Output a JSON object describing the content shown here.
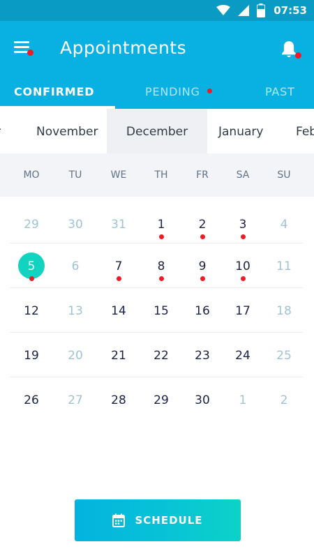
{
  "status_bar": {
    "time": "07:53",
    "icons": [
      "wifi-icon",
      "cell-signal-icon",
      "battery-icon"
    ]
  },
  "app_bar": {
    "title": "Appointments",
    "menu_icon": "menu-icon",
    "menu_has_badge": true,
    "bell_icon": "bell-icon",
    "bell_has_badge": true
  },
  "tabs": [
    {
      "label": "CONFIRMED",
      "selected": true,
      "has_badge": false
    },
    {
      "label": "PENDING",
      "selected": false,
      "has_badge": true
    },
    {
      "label": "PAST",
      "selected": false,
      "has_badge": false
    }
  ],
  "months": [
    {
      "label": "r",
      "selected": false
    },
    {
      "label": "November",
      "selected": false
    },
    {
      "label": "December",
      "selected": true
    },
    {
      "label": "January",
      "selected": false
    },
    {
      "label": "Feb",
      "selected": false
    }
  ],
  "weekdays": [
    "MO",
    "TU",
    "WE",
    "TH",
    "FR",
    "SA",
    "SU"
  ],
  "calendar": {
    "weeks": [
      [
        {
          "d": "29",
          "muted": true
        },
        {
          "d": "30",
          "muted": true
        },
        {
          "d": "31",
          "muted": true
        },
        {
          "d": "1",
          "event": true
        },
        {
          "d": "2",
          "event": true
        },
        {
          "d": "3",
          "event": true
        },
        {
          "d": "4",
          "muted": true
        }
      ],
      [
        {
          "d": "5",
          "today": true,
          "event": true
        },
        {
          "d": "6",
          "muted": true
        },
        {
          "d": "7",
          "event": true
        },
        {
          "d": "8",
          "event": true
        },
        {
          "d": "9",
          "event": true
        },
        {
          "d": "10",
          "event": true
        },
        {
          "d": "11",
          "muted": true
        }
      ],
      [
        {
          "d": "12"
        },
        {
          "d": "13",
          "muted": true
        },
        {
          "d": "14"
        },
        {
          "d": "15"
        },
        {
          "d": "16"
        },
        {
          "d": "17"
        },
        {
          "d": "18",
          "muted": true
        }
      ],
      [
        {
          "d": "19"
        },
        {
          "d": "20",
          "muted": true
        },
        {
          "d": "21"
        },
        {
          "d": "22"
        },
        {
          "d": "23"
        },
        {
          "d": "24"
        },
        {
          "d": "25",
          "muted": true
        }
      ],
      [
        {
          "d": "26"
        },
        {
          "d": "27",
          "muted": true
        },
        {
          "d": "28"
        },
        {
          "d": "29"
        },
        {
          "d": "30"
        },
        {
          "d": "1",
          "muted": true
        },
        {
          "d": "2",
          "muted": true
        }
      ]
    ]
  },
  "schedule_button": {
    "label": "SCHEDULE",
    "icon": "calendar-icon"
  },
  "colors": {
    "status_bar": "#0a9bc4",
    "app_bar": "#09b1e3",
    "badge": "#ee1c25",
    "today": "#12d3c0",
    "day_text": "#1b2248",
    "muted_text": "#9fc4d4"
  }
}
